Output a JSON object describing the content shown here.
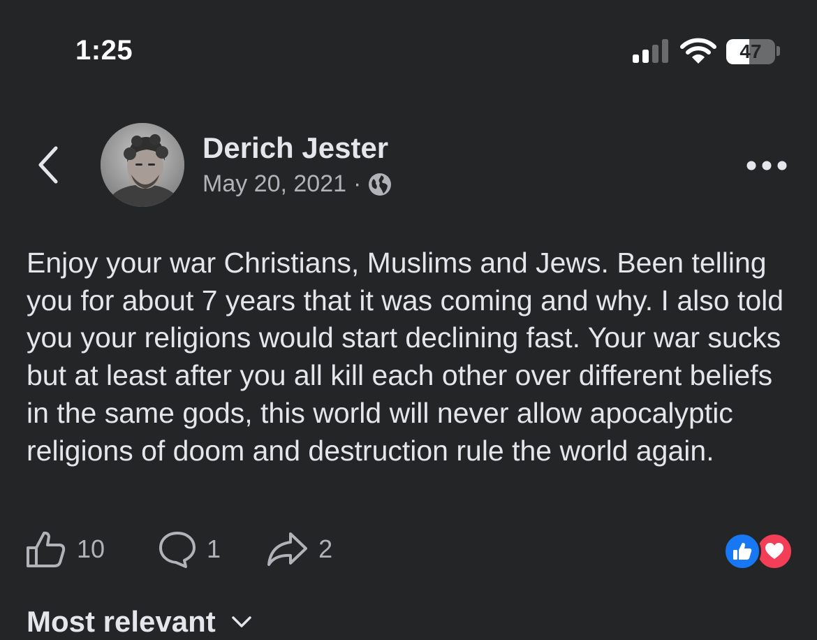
{
  "status_bar": {
    "time": "1:25",
    "battery_percent": "47"
  },
  "post": {
    "author": "Derich Jester",
    "date": "May 20, 2021",
    "separator": "·",
    "audience_icon": "globe-icon",
    "text": "Enjoy your war Christians, Muslims and Jews. Been telling you for about 7 years that it was coming and why. I also told you your religions would start declining fast. Your war sucks but at least after you all kill each other over different beliefs in the same gods, this world will never allow apocalyptic religions of doom and destruction rule the world again."
  },
  "actions": {
    "like_count": "10",
    "comment_count": "1",
    "share_count": "2"
  },
  "reactions": [
    "like",
    "love"
  ],
  "comments": {
    "sort_label": "Most relevant"
  },
  "colors": {
    "background": "#242526",
    "primary_text": "#e4e6eb",
    "secondary_text": "#b0b3b8",
    "like_blue": "#1877f2",
    "love_red": "#f33e58"
  }
}
